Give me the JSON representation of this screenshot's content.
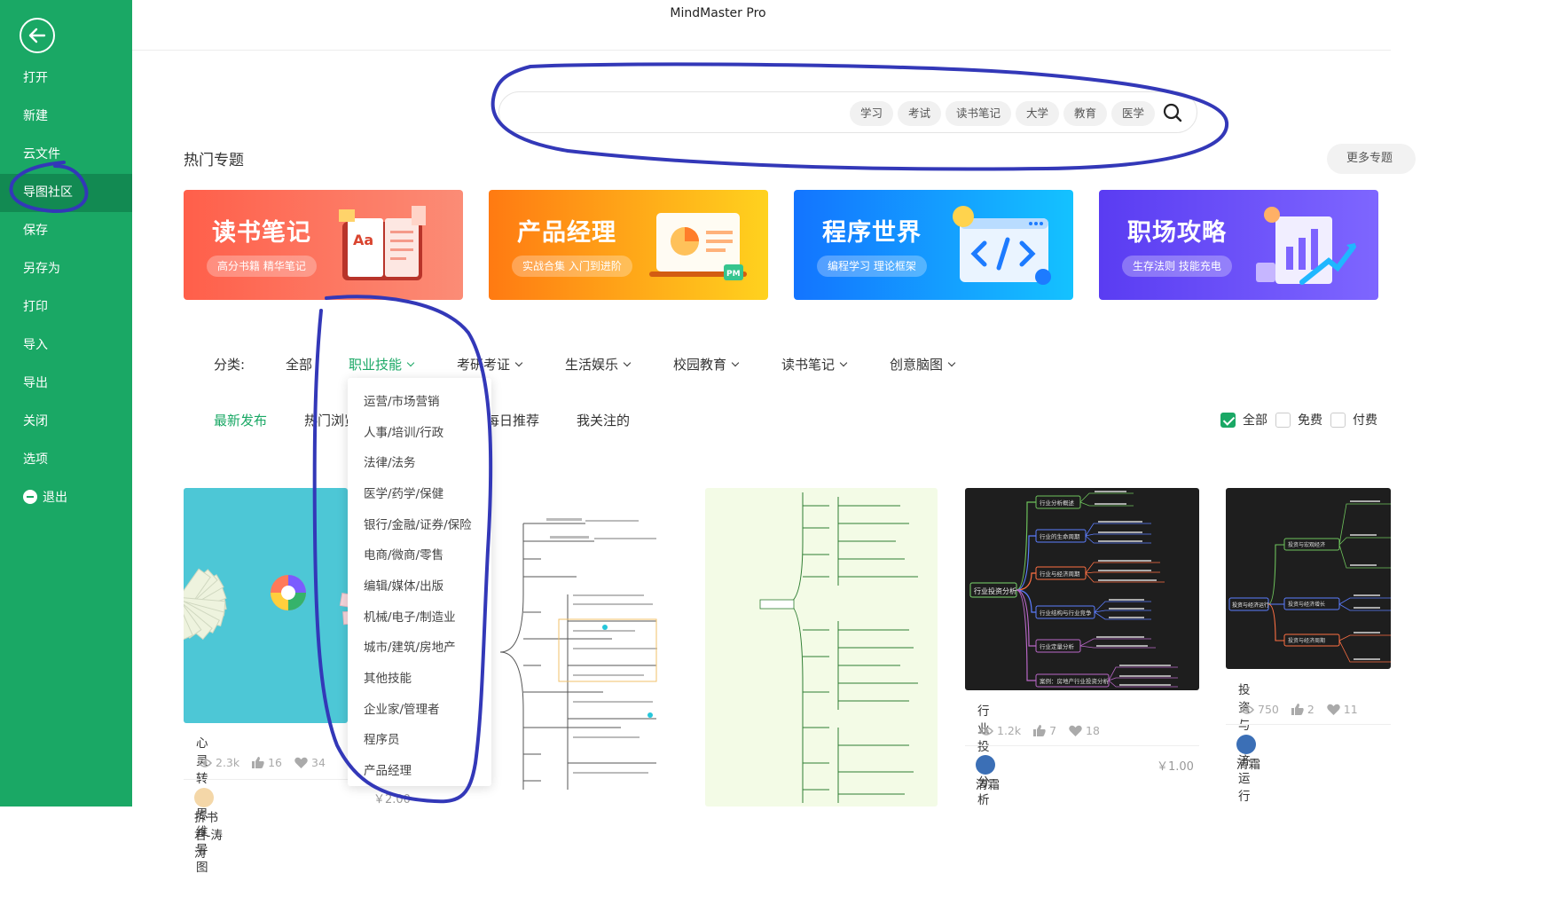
{
  "app": {
    "title": "MindMaster Pro"
  },
  "sidebar": {
    "items": [
      {
        "label": "打开"
      },
      {
        "label": "新建"
      },
      {
        "label": "云文件"
      },
      {
        "label": "导图社区"
      },
      {
        "label": "保存"
      },
      {
        "label": "另存为"
      },
      {
        "label": "打印"
      },
      {
        "label": "导入"
      },
      {
        "label": "导出"
      },
      {
        "label": "关闭"
      },
      {
        "label": "选项"
      },
      {
        "label": "退出"
      }
    ],
    "active_index": 3
  },
  "search": {
    "placeholder": "",
    "tags": [
      "学习",
      "考试",
      "读书笔记",
      "大学",
      "教育",
      "医学"
    ]
  },
  "hot_topics": {
    "title": "热门专题",
    "more_label": "更多专题",
    "banners": [
      {
        "title": "读书笔记",
        "subtitle": "高分书籍 精华笔记",
        "color_from": "#ff5f4a",
        "color_to": "#fb8c76"
      },
      {
        "title": "产品经理",
        "subtitle": "实战合集 入门到进阶",
        "color_from": "#ff7a12",
        "color_to": "#ffd21e"
      },
      {
        "title": "程序世界",
        "subtitle": "编程学习 理论框架",
        "color_from": "#1374ff",
        "color_to": "#14c2ff"
      },
      {
        "title": "职场攻略",
        "subtitle": "生存法则 技能充电",
        "color_from": "#5a3cf2",
        "color_to": "#7e66ff"
      }
    ]
  },
  "categories": {
    "label": "分类:",
    "tabs": [
      "全部",
      "职业技能",
      "考研考证",
      "生活娱乐",
      "校园教育",
      "读书笔记",
      "创意脑图"
    ],
    "active": "职业技能"
  },
  "sort_tabs": [
    "最新发布",
    "热门浏览",
    "每日推荐",
    "我关注的"
  ],
  "filters": [
    {
      "label": "全部",
      "checked": true
    },
    {
      "label": "免费",
      "checked": false
    },
    {
      "label": "付费",
      "checked": false
    }
  ],
  "dropdown": {
    "items": [
      "运营/市场营销",
      "人事/培训/行政",
      "法律/法务",
      "医学/药学/保健",
      "银行/金融/证券/保险",
      "电商/微商/零售",
      "编辑/媒体/出版",
      "机械/电子/制造业",
      "城市/建筑/房地产",
      "其他技能",
      "企业家/管理者",
      "程序员",
      "产品经理"
    ]
  },
  "cards": [
    {
      "name": "心灵转变思维导图",
      "views": "2.3k",
      "likes": "16",
      "favorites": "34",
      "author": "拆书君-涛涛",
      "price": "￥2.00"
    },
    {
      "name": "",
      "views": "",
      "likes": "",
      "favorites": "",
      "author": "",
      "price": ""
    },
    {
      "name": "",
      "views": "",
      "likes": "",
      "favorites": "",
      "author": "",
      "price": ""
    },
    {
      "name": "行业投资分析",
      "views": "1.2k",
      "likes": "7",
      "favorites": "18",
      "author": "清霜",
      "price": "￥1.00"
    },
    {
      "name": "投资与经济运行",
      "views": "750",
      "likes": "2",
      "favorites": "11",
      "author": "清霜",
      "price": ""
    }
  ],
  "thumb_texts": {
    "invest": {
      "root": "行业投资分析",
      "branches": [
        "行业分析概述",
        "行业的生命周期",
        "行业与经济周期",
        "行业结构与行业竞争",
        "行业定量分析",
        "案例：房地产行业投资分析"
      ]
    },
    "economy": {
      "root": "投资与经济运行",
      "branches": [
        "投资与宏观经济",
        "投资与经济增长",
        "投资与经济周期"
      ]
    }
  },
  "colors": {
    "sidebar_bg": "#1aa865",
    "sidebar_active": "#128a52",
    "accent": "#1aa865",
    "annotation": "#3338b8"
  }
}
